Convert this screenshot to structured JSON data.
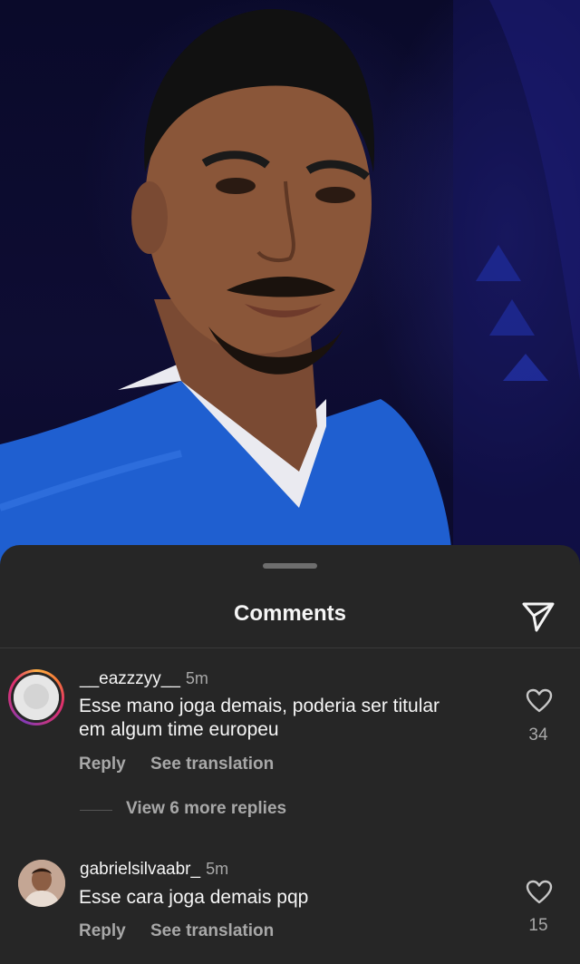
{
  "sheet": {
    "title": "Comments",
    "share_icon": "send-icon"
  },
  "comments": [
    {
      "username": "__eazzzyy__",
      "time": "5m",
      "text_line1": "Esse mano joga demais, poderia ser titular",
      "text_line2": "em algum time europeu",
      "likes": "34",
      "reply_label": "Reply",
      "translate_label": "See translation",
      "view_more_label": "View 6 more replies",
      "has_story_ring": true
    },
    {
      "username": "gabrielsilvaabr_",
      "time": "5m",
      "text_line1": "Esse cara joga demais pqp",
      "likes": "15",
      "reply_label": "Reply",
      "translate_label": "See translation",
      "has_story_ring": false
    }
  ],
  "colors": {
    "sheet_bg": "#262626",
    "text_primary": "#f5f5f5",
    "text_secondary": "#a8a8a8",
    "photo_bg": "#0c0b2e",
    "jersey": "#1f5fd0"
  }
}
